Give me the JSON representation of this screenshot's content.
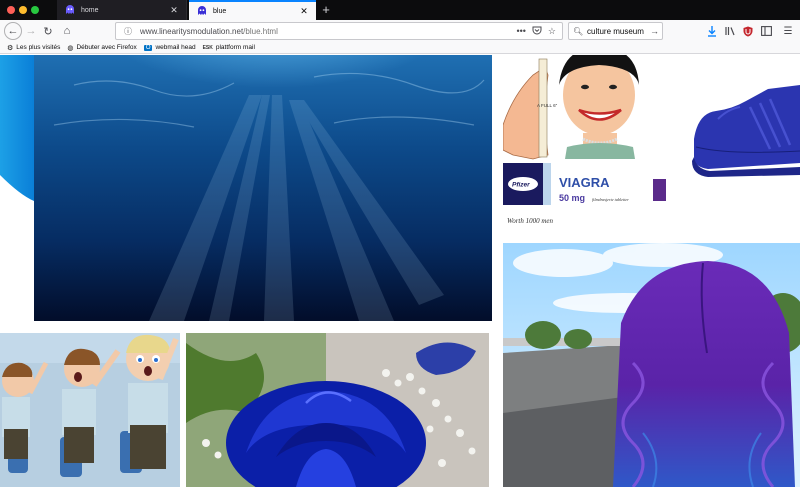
{
  "browser": {
    "tabs": [
      {
        "title": "home",
        "active": false
      },
      {
        "title": "blue",
        "active": true
      }
    ],
    "url_host": "www.linearitysmodulation.net",
    "url_path": "/blue.html",
    "search_value": "culture museum",
    "bookmarks": [
      {
        "label": "Les plus visités",
        "icon": "gear-icon"
      },
      {
        "label": "Débuter avec Firefox",
        "icon": "firefox-icon"
      },
      {
        "label": "webmail head",
        "icon": "outlook-icon",
        "icon_text": "O"
      },
      {
        "label": "plattform mail",
        "icon": "esk-icon",
        "icon_text": "ESK"
      }
    ],
    "colors": {
      "tab_strip": "#0c0c0d",
      "active_tab_accent": "#0a84ff",
      "toolbar": "#f9f9fa"
    }
  },
  "page": {
    "ad_text": {
      "brand": "VIAGRA",
      "maker": "Pfizer",
      "dose": "50 mg",
      "dose_note": "filmdrasjerte tabletter",
      "ruler_label": "A FULL 6\"",
      "signature": "Worth 1000 men"
    }
  }
}
